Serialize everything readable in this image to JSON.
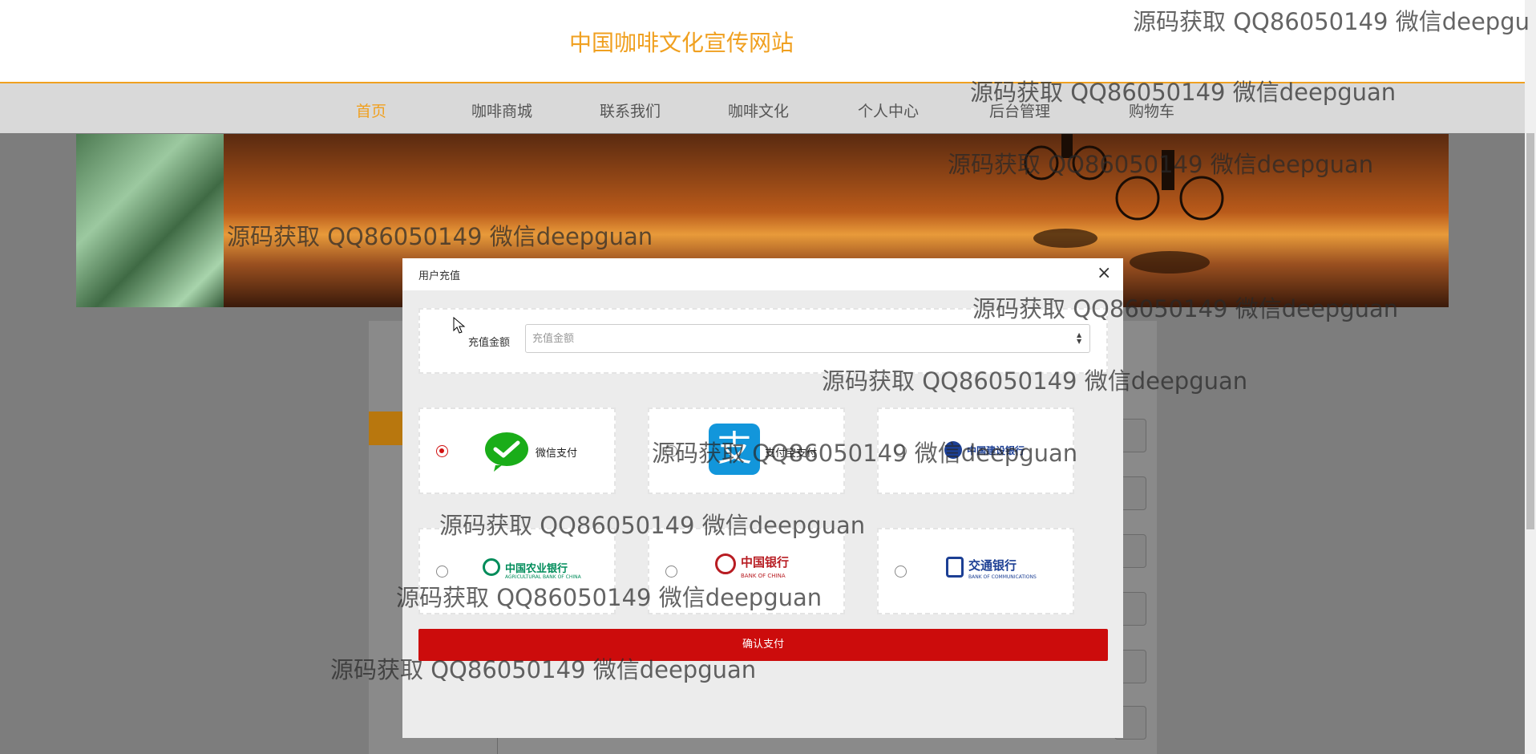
{
  "site": {
    "title": "中国咖啡文化宣传网站"
  },
  "nav": {
    "items": [
      "首页",
      "咖啡商城",
      "联系我们",
      "咖啡文化",
      "个人中心",
      "后台管理",
      "购物车"
    ]
  },
  "modal": {
    "title": "用户充值",
    "close_icon": "×",
    "amount_label": "充值金额",
    "amount_placeholder": "充值金额",
    "payments": [
      {
        "label": "微信支付",
        "selected": true
      },
      {
        "label": "支付宝支付",
        "selected": false
      },
      {
        "label": "中国建设银行",
        "selected": false
      },
      {
        "label": "中国农业银行",
        "sublabel": "AGRICULTURAL BANK OF CHINA",
        "selected": false
      },
      {
        "label": "中国银行",
        "sublabel": "BANK OF CHINA",
        "selected": false
      },
      {
        "label": "交通银行",
        "sublabel": "BANK OF COMMUNICATIONS",
        "selected": false
      }
    ],
    "confirm_label": "确认支付"
  },
  "watermark": {
    "text": "源码获取 QQ86050149 微信deepguan",
    "text_cut": "源码获取 QQ86050149 微信deepgu"
  },
  "colors": {
    "accent": "#f0a020",
    "primary": "#cc0c0c",
    "wechat": "#1aad19",
    "alipay": "#1296db",
    "abc": "#008c5a",
    "boc": "#b81c22",
    "comm": "#1c3f94"
  }
}
